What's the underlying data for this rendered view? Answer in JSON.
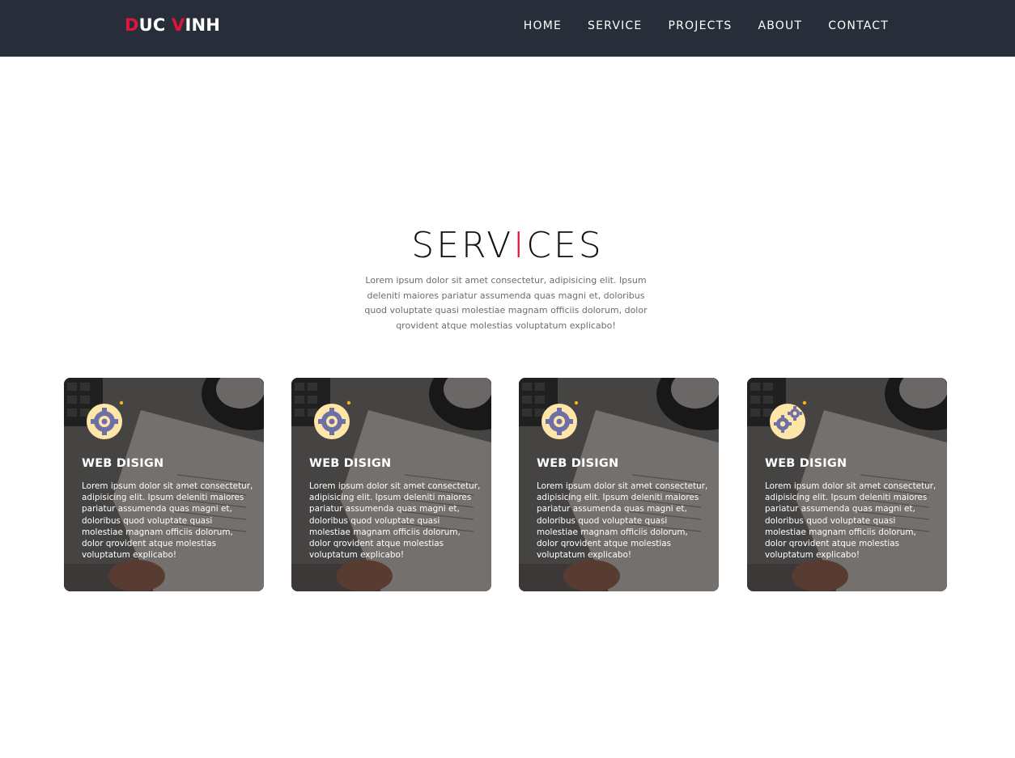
{
  "brand": {
    "first": "DUC",
    "second": "VINH",
    "accent_color": "#e0143c"
  },
  "nav": {
    "items": [
      "HOME",
      "SERVICE",
      "PROJECTS",
      "ABOUT",
      "CONTACT"
    ]
  },
  "services": {
    "title_before": "SERV",
    "title_accent": "I",
    "title_after": "CES",
    "description": "Lorem ipsum dolor sit amet consectetur, adipisicing elit. Ipsum deleniti maiores pariatur assumenda quas magni et, doloribus quod voluptate quasi molestiae magnam officiis dolorum, dolor qrovident atque molestias voluptatum explicabo!",
    "cards": [
      {
        "icon": "gear-icon",
        "title": "WEB DISIGN",
        "text": "Lorem ipsum dolor sit amet consectetur, adipisicing elit. Ipsum deleniti maiores pariatur assumenda quas magni et, doloribus quod voluptate quasi molestiae magnam officiis dolorum, dolor qrovident atque molestias voluptatum explicabo!"
      },
      {
        "icon": "gear-icon",
        "title": "WEB DISIGN",
        "text": "Lorem ipsum dolor sit amet consectetur, adipisicing elit. Ipsum deleniti maiores pariatur assumenda quas magni et, doloribus quod voluptate quasi molestiae magnam officiis dolorum, dolor qrovident atque molestias voluptatum explicabo!"
      },
      {
        "icon": "gear-icon",
        "title": "WEB DISIGN",
        "text": "Lorem ipsum dolor sit amet consectetur, adipisicing elit. Ipsum deleniti maiores pariatur assumenda quas magni et, doloribus quod voluptate quasi molestiae magnam officiis dolorum, dolor qrovident atque molestias voluptatum explicabo!"
      },
      {
        "icon": "gears-icon",
        "title": "WEB DISIGN",
        "text": "Lorem ipsum dolor sit amet consectetur, adipisicing elit. Ipsum deleniti maiores pariatur assumenda quas magni et, doloribus quod voluptate quasi molestiae magnam officiis dolorum, dolor qrovident atque molestias voluptatum explicabo!"
      }
    ]
  },
  "colors": {
    "navbar_bg": "#282e39",
    "accent": "#e0143c",
    "icon_bg": "#fde6a8",
    "icon_gear": "#6f6fa8"
  }
}
